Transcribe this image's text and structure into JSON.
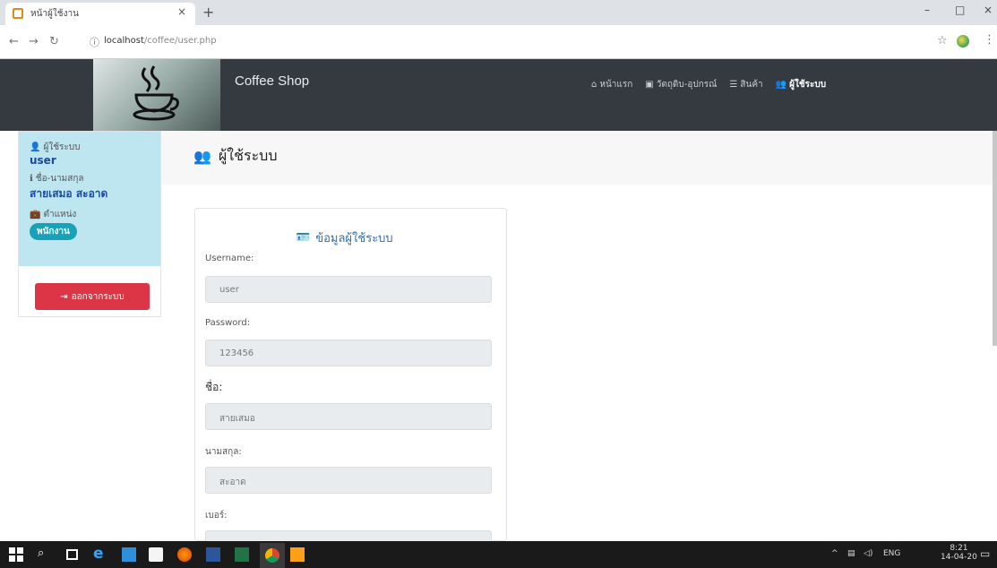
{
  "browser": {
    "tab_title": "หน้าผู้ใช้งาน",
    "tab_close": "×",
    "new_tab": "+",
    "url_host": "localhost",
    "url_path": "/coffee/user.php",
    "controls": {
      "minimize": "–",
      "maximize": "□",
      "close": "×"
    }
  },
  "navbar": {
    "brand": "Coffee Shop",
    "links": [
      {
        "icon": "home-icon",
        "label": "หน้าแรก",
        "active": false
      },
      {
        "icon": "box-icon",
        "label": "วัตถุดิบ-อุปกรณ์",
        "active": false
      },
      {
        "icon": "list-icon",
        "label": "สินค้า",
        "active": false
      },
      {
        "icon": "users-icon",
        "label": "ผู้ใช้ระบบ",
        "active": true
      }
    ]
  },
  "sidebar": {
    "user_label": "ผู้ใช้ระบบ",
    "user_value": "user",
    "name_label": "ชื่อ-นามสกุล",
    "name_value": "สายเสมอ สะอาด",
    "position_label": "ตำแหน่ง",
    "position_value": "พนักงาน",
    "logout_label": "ออกจากระบบ"
  },
  "page": {
    "title": "ผู้ใช้ระบบ"
  },
  "form": {
    "title": "ข้อมูลผู้ใช้ระบบ",
    "fields": [
      {
        "label": "Username:",
        "value": "user"
      },
      {
        "label": "Password:",
        "value": "123456"
      },
      {
        "label": "ชื่อ:",
        "value": "สายเสมอ"
      },
      {
        "label": "นามสกุล:",
        "value": "สะอาด"
      },
      {
        "label": "เบอร์:",
        "value": ""
      }
    ]
  },
  "taskbar": {
    "language": "ENG",
    "time": "8:21",
    "date": "14-04-20"
  },
  "colors": {
    "navbar": "#343a40",
    "sidebar_info": "#bde6f0",
    "logout": "#dc3545",
    "badge": "#17a2b8",
    "link": "#2f6fb5"
  }
}
